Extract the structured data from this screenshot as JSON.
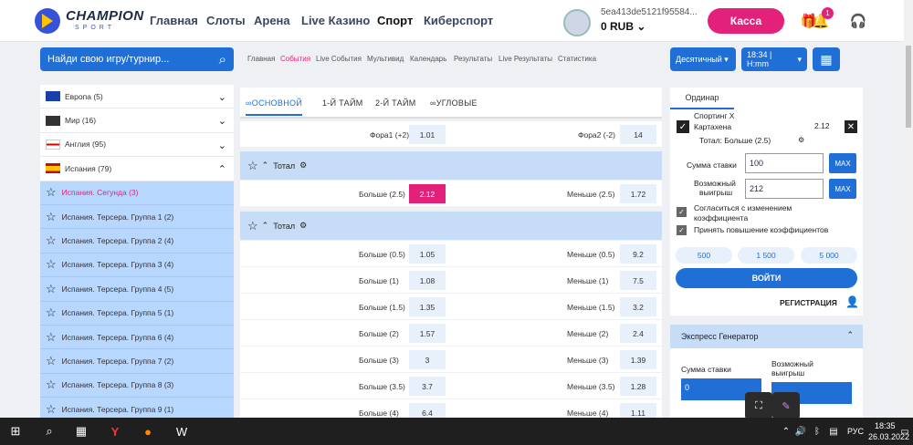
{
  "header": {
    "brand": "CHAMPION",
    "brand_sub": "SPORT",
    "nav": [
      "Главная",
      "Слоты",
      "Арена",
      "Live Казино",
      "Спорт",
      "Киберспорт"
    ],
    "account_id": "5ea413de5121f95584...",
    "balance": "0 RUB",
    "kassa": "Касса",
    "notifications": "1"
  },
  "search": {
    "placeholder": "Найди свою игру/турнир..."
  },
  "subnav": [
    "Главная",
    "События",
    "Live События",
    "Мультивид",
    "Календарь",
    "Результаты",
    "Live Результаты",
    "Статистика"
  ],
  "controls": {
    "odds_format": "Десятичный",
    "time_format": "18:34 | H:mm"
  },
  "sidebar": {
    "countries": [
      {
        "name": "Европа (5)"
      },
      {
        "name": "Мир (16)"
      },
      {
        "name": "Англия (95)"
      },
      {
        "name": "Испания (79)"
      }
    ],
    "leagues": [
      "Испания. Сегунда (3)",
      "Испания. Терсера. Группа 1 (2)",
      "Испания. Терсера. Группа 2 (4)",
      "Испания. Терсера. Группа 3 (4)",
      "Испания. Терсера. Группа 4 (5)",
      "Испания. Терсера. Группа 5 (1)",
      "Испания. Терсера. Группа 6 (4)",
      "Испания. Терсера. Группа 7 (2)",
      "Испания. Терсера. Группа 8 (3)",
      "Испания. Терсера. Группа 9 (1)"
    ]
  },
  "tabs": [
    "ОСНОВНОЙ",
    "1-Й ТАЙМ",
    "2-Й ТАЙМ",
    "УГЛОВЫЕ"
  ],
  "market": {
    "fora1_label": "Фора1 (+2)",
    "fora1_odd": "1.01",
    "fora2_label": "Фора2 (-2)",
    "fora2_odd": "14",
    "total_title": "Тотал",
    "total_single": {
      "over_label": "Больше (2.5)",
      "over_odd": "2.12",
      "under_label": "Меньше (2.5)",
      "under_odd": "1.72"
    },
    "totals": [
      {
        "over_label": "Больше (0.5)",
        "over_odd": "1.05",
        "under_label": "Меньше (0.5)",
        "under_odd": "9.2"
      },
      {
        "over_label": "Больше (1)",
        "over_odd": "1.08",
        "under_label": "Меньше (1)",
        "under_odd": "7.5"
      },
      {
        "over_label": "Больше (1.5)",
        "over_odd": "1.35",
        "under_label": "Меньше (1.5)",
        "under_odd": "3.2"
      },
      {
        "over_label": "Больше (2)",
        "over_odd": "1.57",
        "under_label": "Меньше (2)",
        "under_odd": "2.4"
      },
      {
        "over_label": "Больше (3)",
        "over_odd": "3",
        "under_label": "Меньше (3)",
        "under_odd": "1.39"
      },
      {
        "over_label": "Больше (3.5)",
        "over_odd": "3.7",
        "under_label": "Меньше (3.5)",
        "under_odd": "1.28"
      },
      {
        "over_label": "Больше (4)",
        "over_odd": "6.4",
        "under_label": "Меньше (4)",
        "under_odd": "1.11"
      }
    ]
  },
  "betslip": {
    "tab": "Ординар",
    "match_line1": "Спортинг Х",
    "match_line2": "Картахена",
    "selection": "Тотал: Больше (2.5)",
    "odd": "2.12",
    "stake_label": "Сумма ставки",
    "stake_value": "100",
    "win_label1": "Возможный",
    "win_label2": "выигрыш",
    "win_value": "212",
    "max": "MAX",
    "agree1": "Согласиться с изменением",
    "agree2": "коэффициента",
    "accept_raise": "Принять повышение коэффициентов",
    "quick": [
      "500",
      "1 500",
      "5 000"
    ],
    "login": "ВОЙТИ",
    "register": "РЕГИСТРАЦИЯ"
  },
  "express": {
    "title": "Экспресс Генератор",
    "stake_label": "Сумма ставки",
    "stake_value": "0",
    "win_label1": "Возможный",
    "win_label2": "выигрыш"
  },
  "taskbar": {
    "lang": "РУС",
    "time": "18:35",
    "date": "26.03.2022"
  }
}
